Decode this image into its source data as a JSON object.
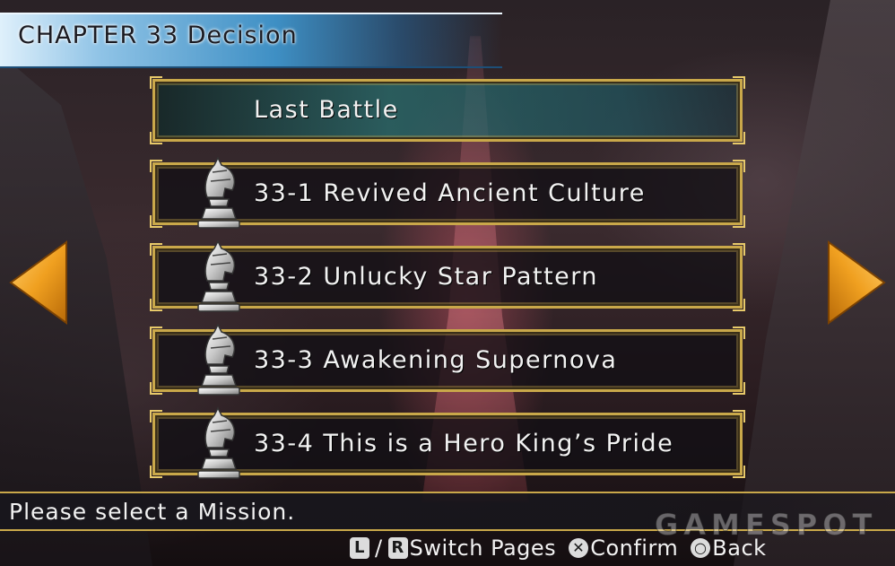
{
  "header": {
    "chapter_title": "CHAPTER 33 Decision"
  },
  "missions": [
    {
      "label": "Last Battle",
      "selected": true,
      "icon": null
    },
    {
      "label": "33-1 Revived Ancient Culture",
      "selected": false,
      "icon": "knight-chess-piece-icon"
    },
    {
      "label": "33-2 Unlucky Star Pattern",
      "selected": false,
      "icon": "knight-chess-piece-icon"
    },
    {
      "label": "33-3 Awakening Supernova",
      "selected": false,
      "icon": "knight-chess-piece-icon"
    },
    {
      "label": "33-4 This is a Hero King’s Pride",
      "selected": false,
      "icon": "knight-chess-piece-icon"
    }
  ],
  "navigation": {
    "left_arrow_icon": "orange-left-arrow-icon",
    "right_arrow_icon": "orange-right-arrow-icon"
  },
  "status": {
    "prompt": "Please select a Mission."
  },
  "controls": {
    "l_button": "L",
    "r_button": "R",
    "switch_label": "Switch Pages",
    "confirm_symbol": "✕",
    "confirm_label": "Confirm",
    "back_symbol": "○",
    "back_label": "Back"
  },
  "watermark": {
    "text": "GAMESPOT"
  },
  "colors": {
    "frame_gold": "#c9a84a",
    "arrow_orange": "#f0a020",
    "header_blue": "#3e8fc4",
    "selected_teal": "#286e6e"
  }
}
